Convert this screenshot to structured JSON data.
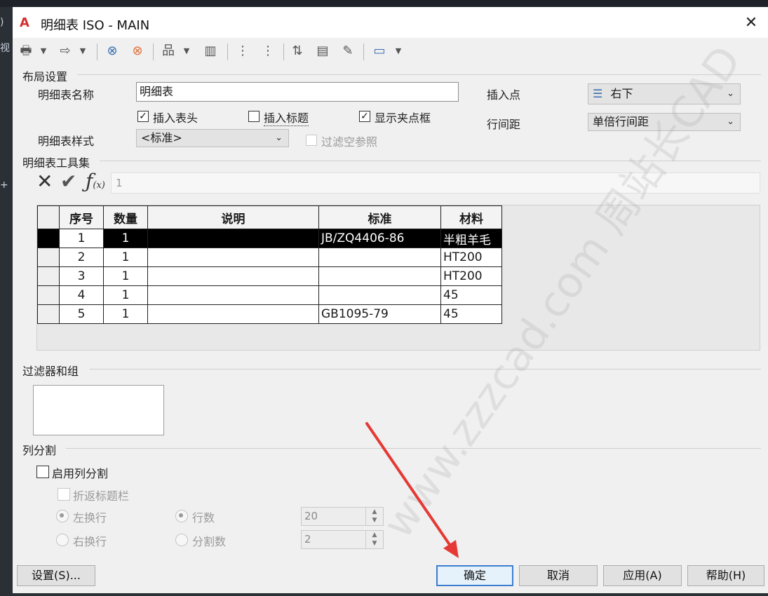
{
  "window": {
    "title": "明细表 ISO - MAIN",
    "close": "✕",
    "logo": "A"
  },
  "layout_section": {
    "label": "布局设置",
    "table_name_label": "明细表名称",
    "table_name_value": "明细表",
    "insert_header": {
      "label": "插入表头",
      "checked": true
    },
    "insert_title": {
      "label": "插入标题",
      "checked": false
    },
    "show_grips": {
      "label": "显示夹点框",
      "checked": true
    },
    "style_label": "明细表样式",
    "style_value": "<标准>",
    "filter_empty": {
      "label": "过滤空参照",
      "checked": false,
      "disabled": true
    },
    "insert_point_label": "插入点",
    "insert_point_value": "右下",
    "line_spacing_label": "行间距",
    "line_spacing_value": "单倍行间距"
  },
  "toolset": {
    "label": "明细表工具集",
    "formula_value": "1"
  },
  "table": {
    "headers": [
      "序号",
      "数量",
      "说明",
      "标准",
      "材料"
    ],
    "rows": [
      [
        "1",
        "1",
        "",
        "JB/ZQ4406-86",
        "半粗羊毛"
      ],
      [
        "2",
        "1",
        "",
        "",
        "HT200"
      ],
      [
        "3",
        "1",
        "",
        "",
        "HT200"
      ],
      [
        "4",
        "1",
        "",
        "",
        "45"
      ],
      [
        "5",
        "1",
        "",
        "GB1095-79",
        "45"
      ]
    ],
    "selected_row": 0
  },
  "filter_section": {
    "label": "过滤器和组"
  },
  "split_section": {
    "label": "列分割",
    "enable": {
      "label": "启用列分割",
      "checked": false
    },
    "fold_title": {
      "label": "折返标题栏",
      "disabled": true
    },
    "left_wrap": {
      "label": "左换行",
      "selected": true
    },
    "right_wrap": {
      "label": "右换行",
      "selected": false
    },
    "rows_opt": {
      "label": "行数",
      "selected": true,
      "value": "20"
    },
    "splits_opt": {
      "label": "分割数",
      "selected": false,
      "value": "2"
    }
  },
  "buttons": {
    "settings": "设置(S)...",
    "ok": "确定",
    "cancel": "取消",
    "apply": "应用(A)",
    "help": "帮助(H)"
  },
  "watermark": "www.zzzcad.com 周站长CAD",
  "colors": {
    "accent": "#3c7fd1",
    "arrow": "#e53935",
    "logo": "#d32f2f"
  }
}
